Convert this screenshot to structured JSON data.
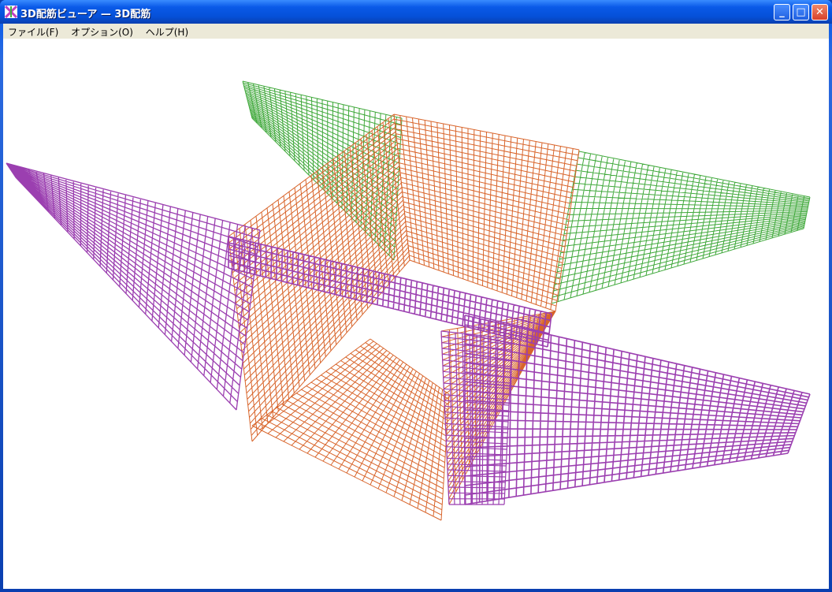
{
  "window": {
    "title": "3D配筋ビューア — 3D配筋",
    "minimize": "_",
    "maximize": "□",
    "close": "✕"
  },
  "menu": [
    "ファイル(F)",
    "オプション(O)",
    "ヘルプ(H)"
  ],
  "colors": {
    "purple": "#9b3fb0",
    "orange": "#d8642a",
    "green": "#3fa83a"
  }
}
